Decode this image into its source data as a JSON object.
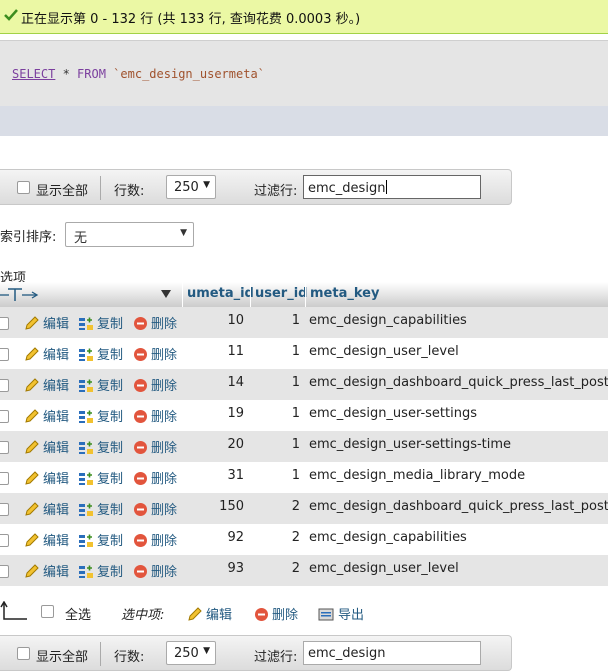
{
  "success": {
    "message": "正在显示第 0 - 132 行 (共 133 行, 查询花费 0.0003 秒。)"
  },
  "sql": {
    "select": "SELECT",
    "star": " * ",
    "from": "FROM",
    "table": " `emc_design_usermeta`"
  },
  "nav_top": {
    "show_all": "显示全部",
    "rows_label": "行数:",
    "rows_value": "250",
    "filter_label": "过滤行:",
    "filter_value": "emc_design"
  },
  "nav_bottom": {
    "show_all": "显示全部",
    "rows_label": "行数:",
    "rows_value": "250",
    "filter_label": "过滤行:",
    "filter_value": "emc_design"
  },
  "sort": {
    "label": "索引排序:",
    "value": "无"
  },
  "options_label": "选项",
  "columns": [
    "umeta_id",
    "user_id",
    "meta_key"
  ],
  "actions": {
    "edit": "编辑",
    "copy": "复制",
    "delete": "删除"
  },
  "rows": [
    {
      "umeta_id": "10",
      "user_id": "1",
      "meta_key": "emc_design_capabilities"
    },
    {
      "umeta_id": "11",
      "user_id": "1",
      "meta_key": "emc_design_user_level"
    },
    {
      "umeta_id": "14",
      "user_id": "1",
      "meta_key": "emc_design_dashboard_quick_press_last_post_id"
    },
    {
      "umeta_id": "19",
      "user_id": "1",
      "meta_key": "emc_design_user-settings"
    },
    {
      "umeta_id": "20",
      "user_id": "1",
      "meta_key": "emc_design_user-settings-time"
    },
    {
      "umeta_id": "31",
      "user_id": "1",
      "meta_key": "emc_design_media_library_mode"
    },
    {
      "umeta_id": "150",
      "user_id": "2",
      "meta_key": "emc_design_dashboard_quick_press_last_post_id"
    },
    {
      "umeta_id": "92",
      "user_id": "2",
      "meta_key": "emc_design_capabilities"
    },
    {
      "umeta_id": "93",
      "user_id": "2",
      "meta_key": "emc_design_user_level"
    }
  ],
  "footer": {
    "select_all": "全选",
    "with_selected": "选中项:",
    "edit": "编辑",
    "delete": "删除",
    "export": "导出"
  },
  "colors": {
    "link": "#235a81",
    "success_bg": "#ebf8a4",
    "row_alt": "#e5e5e5",
    "delete_red": "#e2553d"
  }
}
